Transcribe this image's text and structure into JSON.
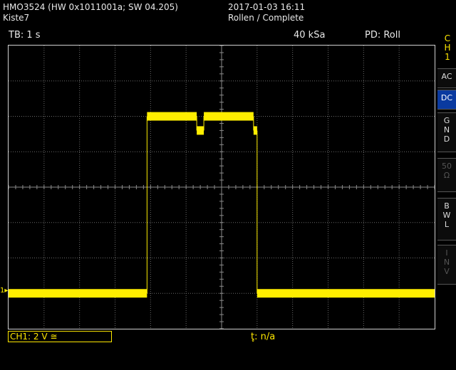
{
  "header": {
    "device": "HMO3524 (HW 0x1011001a; SW 04.205)",
    "name": "Kiste7",
    "datetime": "2017-01-03 16:11",
    "mode": "Rollen / Complete"
  },
  "status": {
    "timebase": "TB: 1 s",
    "sample_rate": "40 kSa",
    "pd": "PD: Roll"
  },
  "side_panel": {
    "channel": "CH 1",
    "channel_lines": [
      "C",
      "H",
      "1"
    ],
    "ac": "AC",
    "dc": "DC",
    "gnd": [
      "G",
      "N",
      "D"
    ],
    "impedance": [
      "50",
      "Ω"
    ],
    "bwl": [
      "B",
      "W",
      "L"
    ],
    "inv": [
      "I",
      "N",
      "V"
    ]
  },
  "footer": {
    "channel_info": "CH1: 2 V ≅",
    "trigger": "t̥: n/a"
  },
  "marker": "1▸",
  "colors": {
    "trace": "#ffee00",
    "grid": "#6a6a6a",
    "accent": "#0a3aa0"
  },
  "chart_data": {
    "type": "line",
    "x_units": "s",
    "y_units": "V",
    "xlim": [
      0,
      12
    ],
    "ylim": [
      -4,
      4
    ],
    "grid": true,
    "segments": [
      {
        "x": [
          0,
          3.9
        ],
        "y": [
          -3.0,
          -3.0
        ]
      },
      {
        "x": [
          3.9,
          5.3
        ],
        "y": [
          2.0,
          2.0
        ]
      },
      {
        "x": [
          5.3,
          5.5
        ],
        "y": [
          1.6,
          1.6
        ]
      },
      {
        "x": [
          5.5,
          6.9
        ],
        "y": [
          2.0,
          2.0
        ]
      },
      {
        "x": [
          6.9,
          7.0
        ],
        "y": [
          1.6,
          1.6
        ]
      },
      {
        "x": [
          7.0,
          12
        ],
        "y": [
          -3.0,
          -3.0
        ]
      }
    ]
  }
}
